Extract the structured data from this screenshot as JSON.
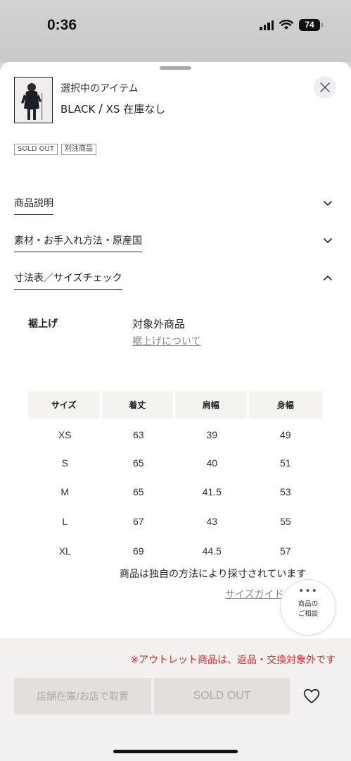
{
  "status_bar": {
    "time": "0:36",
    "battery": "74"
  },
  "item": {
    "caption": "選択中のアイテム",
    "color": "BLACK",
    "separator": "/",
    "size": "XS",
    "stock": "在庫なし"
  },
  "badges": [
    "SOLD OUT",
    "別注商品"
  ],
  "accordions": [
    {
      "title": "商品説明",
      "state": "collapsed"
    },
    {
      "title": "素材・お手入れ方法・原産国",
      "state": "collapsed"
    },
    {
      "title": "寸法表／サイズチェック",
      "state": "expanded"
    }
  ],
  "hem": {
    "label": "裾上げ",
    "value": "対象外商品",
    "link": "裾上げについて"
  },
  "size_table": {
    "headers": [
      "サイズ",
      "着丈",
      "肩幅",
      "身幅"
    ],
    "rows": [
      [
        "XS",
        "63",
        "39",
        "49"
      ],
      [
        "S",
        "65",
        "40",
        "51"
      ],
      [
        "M",
        "65",
        "41.5",
        "53"
      ],
      [
        "L",
        "67",
        "43",
        "55"
      ],
      [
        "XL",
        "69",
        "44.5",
        "57"
      ]
    ]
  },
  "measure_note": "商品は独自の方法により採寸されています",
  "size_guide_link": "サイズガイド",
  "consult": {
    "dots": "•••",
    "line1": "商品の",
    "line2": "ご相談"
  },
  "footer": {
    "outlet_note": "※アウトレット商品は、返品・交換対象外です",
    "store_button": "店舗在庫/お店で取置",
    "soldout_button": "SOLD OUT"
  },
  "icons": [
    "signal-icon",
    "wifi-icon",
    "battery-icon",
    "close-icon",
    "chevron-down-icon",
    "chevron-up-icon",
    "more-dots-icon",
    "heart-icon"
  ],
  "colors": {
    "warning_text": "#d32c2c",
    "disabled_button": "#e2dfdc",
    "table_header_bg": "#f5f3f0"
  }
}
